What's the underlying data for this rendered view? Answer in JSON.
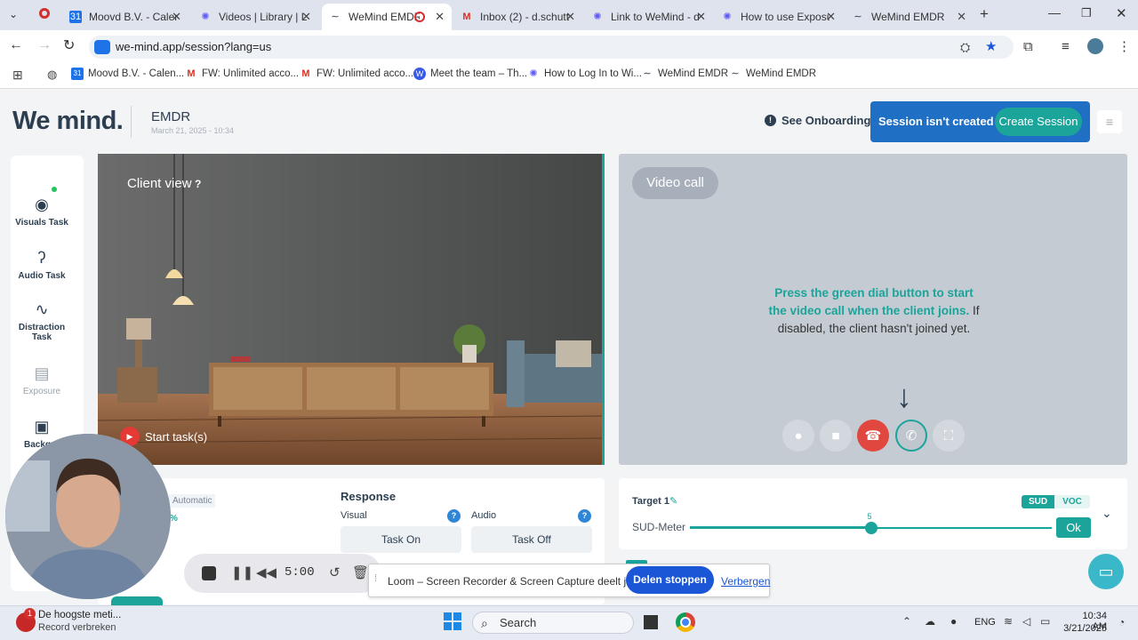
{
  "browser": {
    "tabs": [
      {
        "label": "Moovd B.V. - Calend",
        "icon": "calendar-icon",
        "active": false
      },
      {
        "label": "Videos | Library | Lo",
        "icon": "loom-icon",
        "active": false
      },
      {
        "label": "WeMind EMDR",
        "icon": "wemind-icon",
        "active": true
      },
      {
        "label": "Inbox (2) - d.schutt",
        "icon": "gmail-icon",
        "active": false
      },
      {
        "label": "Link to WeMind - d",
        "icon": "loom-icon",
        "active": false
      },
      {
        "label": "How to use Exposu",
        "icon": "loom-icon",
        "active": false
      },
      {
        "label": "WeMind EMDR",
        "icon": "wemind-icon",
        "active": false
      }
    ],
    "url": "we-mind.app/session?lang=us",
    "bookmarks": [
      {
        "label": "Moovd B.V. - Calen...",
        "icon": "calendar-icon"
      },
      {
        "label": "FW: Unlimited acco...",
        "icon": "gmail-icon"
      },
      {
        "label": "FW: Unlimited acco...",
        "icon": "gmail-icon"
      },
      {
        "label": "Meet the team – Th...",
        "icon": "wordpress-icon"
      },
      {
        "label": "How to Log In to Wi...",
        "icon": "loom-icon"
      },
      {
        "label": "WeMind EMDR",
        "icon": "wemind-icon"
      },
      {
        "label": "WeMind EMDR",
        "icon": "wemind-icon"
      }
    ]
  },
  "header": {
    "logo": "We mind.",
    "session_type": "EMDR",
    "session_date": "March 21, 2025 - 10:34",
    "onboarding": "See Onboarding",
    "session_status": "Session isn't created",
    "create_session": "Create Session"
  },
  "sidebar": {
    "items": [
      {
        "label": "Visuals Task",
        "icon": "eye-icon",
        "disabled": false
      },
      {
        "label": "Audio Task",
        "icon": "ear-icon",
        "disabled": false
      },
      {
        "label": "Distraction Task",
        "icon": "pulse-icon",
        "disabled": false
      },
      {
        "label": "Exposure",
        "icon": "images-icon",
        "disabled": true
      },
      {
        "label": "Backgro",
        "icon": "image-icon",
        "disabled": false
      }
    ]
  },
  "client_view": {
    "title": "Client view",
    "help": "?",
    "start_task": "Start task(s)"
  },
  "video_call": {
    "label": "Video call",
    "message_strong": "Press the green dial button to start the video call when the client joins.",
    "message_rest": " If disabled, the client hasn't joined yet."
  },
  "response": {
    "automatic": "Automatic",
    "pct": "%",
    "title": "Response",
    "visual": "Visual",
    "audio": "Audio",
    "task_on": "Task On",
    "task_off": "Task Off"
  },
  "target": {
    "label": "Target 1",
    "sud_tab": "SUD",
    "voc_tab": "VOC",
    "meter_label": "SUD-Meter",
    "value": "5",
    "ok": "Ok",
    "level": 0.5
  },
  "loom": {
    "timer": "5:00",
    "share_text": "Loom – Screen Recorder & Screen Capture deelt je scherm.",
    "stop_share": "Delen stoppen",
    "hide": "Verbergen"
  },
  "taskbar": {
    "notif_title": "De hoogste meti...",
    "notif_sub": "Record verbreken",
    "notif_badge": "1",
    "search": "Search",
    "lang": "ENG",
    "time": "10:34 AM",
    "date": "3/21/2025"
  }
}
